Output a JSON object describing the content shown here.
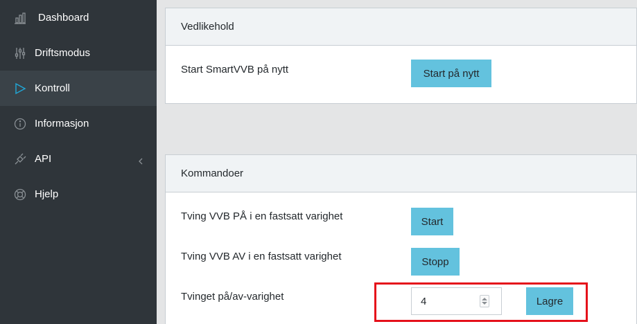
{
  "sidebar": {
    "items": [
      {
        "label": "Dashboard",
        "icon": "bar-chart-icon"
      },
      {
        "label": "Driftsmodus",
        "icon": "sliders-icon"
      },
      {
        "label": "Kontroll",
        "icon": "play-icon",
        "active": true
      },
      {
        "label": "Informasjon",
        "icon": "info-circle-icon"
      },
      {
        "label": "API",
        "icon": "plug-icon",
        "has_submenu": true
      },
      {
        "label": "Hjelp",
        "icon": "life-ring-icon"
      }
    ]
  },
  "maintenance": {
    "title": "Vedlikehold",
    "restart_label": "Start SmartVVB på nytt",
    "restart_button": "Start på nytt"
  },
  "commands": {
    "title": "Kommandoer",
    "force_on_label": "Tving VVB PÅ i en fastsatt varighet",
    "force_on_button": "Start",
    "force_off_label": "Tving VVB AV i en fastsatt varighet",
    "force_off_button": "Stopp",
    "duration_label": "Tvinget på/av-varighet",
    "duration_value": "4",
    "save_button": "Lagre"
  },
  "colors": {
    "sidebar_bg": "#2f353a",
    "sidebar_active": "#3a4248",
    "button_bg": "#63c2de",
    "highlight": "#e5101a"
  }
}
